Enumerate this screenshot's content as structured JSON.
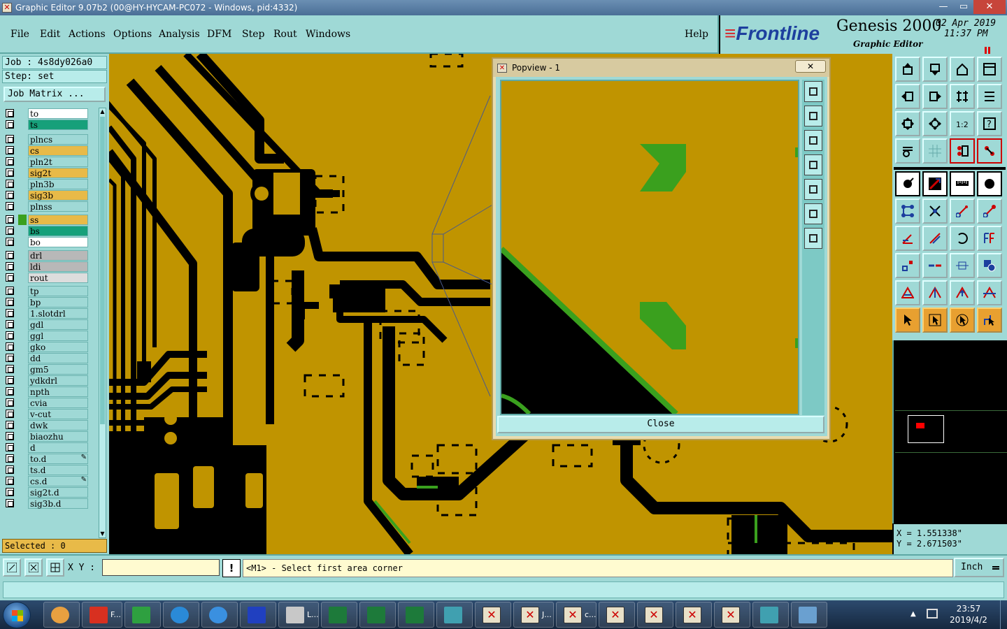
{
  "window": {
    "title": "Graphic Editor 9.07b2 (00@HY-HYCAM-PC072 - Windows, pid:4332)",
    "min_glyph": "—",
    "max_glyph": "▭",
    "close_glyph": "✕"
  },
  "menu": {
    "items": [
      "File",
      "Edit",
      "Actions",
      "Options",
      "Analysis",
      "DFM",
      "Step",
      "Rout",
      "Windows"
    ],
    "help": "Help"
  },
  "brand": {
    "logo_prefix": "≡",
    "logo": "Frontline",
    "product": "Genesis 2000",
    "subtitle": "Graphic Editor",
    "date": "02 Apr 2019",
    "time": "11:37 PM"
  },
  "left_panel": {
    "job": "Job : 4s8dy026a0",
    "step": "Step: set",
    "job_matrix": "Job Matrix ...",
    "selected": "Selected : 0",
    "layers": [
      {
        "name": "to",
        "color": "#ffffff",
        "swatch": "",
        "edit": false
      },
      {
        "name": "ts",
        "color": "#16a07a",
        "swatch": "",
        "edit": false
      },
      {
        "name": "plncs",
        "color": "#9fd9d6",
        "swatch": "",
        "edit": false
      },
      {
        "name": "cs",
        "color": "#e8ba48",
        "swatch": "",
        "edit": false
      },
      {
        "name": "pln2t",
        "color": "#9fd9d6",
        "swatch": "",
        "edit": false
      },
      {
        "name": "sig2t",
        "color": "#e8ba48",
        "swatch": "",
        "edit": false
      },
      {
        "name": "pln3b",
        "color": "#9fd9d6",
        "swatch": "",
        "edit": false
      },
      {
        "name": "sig3b",
        "color": "#e8ba48",
        "swatch": "",
        "edit": false
      },
      {
        "name": "plnss",
        "color": "#9fd9d6",
        "swatch": "",
        "edit": false
      },
      {
        "name": "ss",
        "color": "#e8ba48",
        "swatch": "#3aa01e",
        "edit": false
      },
      {
        "name": "bs",
        "color": "#16a07a",
        "swatch": "",
        "edit": false
      },
      {
        "name": "bo",
        "color": "#ffffff",
        "swatch": "",
        "edit": false
      },
      {
        "name": "drl",
        "color": "#b8b8b8",
        "swatch": "",
        "edit": false
      },
      {
        "name": "ldi",
        "color": "#b8b8b8",
        "swatch": "",
        "edit": false
      },
      {
        "name": "rout",
        "color": "#dddddd",
        "swatch": "",
        "edit": false
      },
      {
        "name": "tp",
        "color": "#9fd9d6",
        "swatch": "",
        "edit": false
      },
      {
        "name": "bp",
        "color": "#9fd9d6",
        "swatch": "",
        "edit": false
      },
      {
        "name": "1.slotdrl",
        "color": "#9fd9d6",
        "swatch": "",
        "edit": false
      },
      {
        "name": "gdl",
        "color": "#9fd9d6",
        "swatch": "",
        "edit": false
      },
      {
        "name": "ggl",
        "color": "#9fd9d6",
        "swatch": "",
        "edit": false
      },
      {
        "name": "gko",
        "color": "#9fd9d6",
        "swatch": "",
        "edit": false
      },
      {
        "name": "dd",
        "color": "#9fd9d6",
        "swatch": "",
        "edit": false
      },
      {
        "name": "gm5",
        "color": "#9fd9d6",
        "swatch": "",
        "edit": false
      },
      {
        "name": "ydkdrl",
        "color": "#9fd9d6",
        "swatch": "",
        "edit": false
      },
      {
        "name": "npth",
        "color": "#9fd9d6",
        "swatch": "",
        "edit": false
      },
      {
        "name": "cvia",
        "color": "#9fd9d6",
        "swatch": "",
        "edit": false
      },
      {
        "name": "v-cut",
        "color": "#9fd9d6",
        "swatch": "",
        "edit": false
      },
      {
        "name": "dwk",
        "color": "#9fd9d6",
        "swatch": "",
        "edit": false
      },
      {
        "name": "biaozhu",
        "color": "#9fd9d6",
        "swatch": "",
        "edit": false
      },
      {
        "name": "d",
        "color": "#9fd9d6",
        "swatch": "",
        "edit": false
      },
      {
        "name": "to.d",
        "color": "#9fd9d6",
        "swatch": "",
        "edit": true
      },
      {
        "name": "ts.d",
        "color": "#9fd9d6",
        "swatch": "",
        "edit": false
      },
      {
        "name": "cs.d",
        "color": "#9fd9d6",
        "swatch": "",
        "edit": true
      },
      {
        "name": "sig2t.d",
        "color": "#9fd9d6",
        "swatch": "",
        "edit": false
      },
      {
        "name": "sig3b.d",
        "color": "#9fd9d6",
        "swatch": "",
        "edit": false
      }
    ],
    "edit_glyph": "✎"
  },
  "popview": {
    "title": "Popview - 1",
    "close_x": "✕",
    "close_button": "Close"
  },
  "coords": {
    "x": "X = 1.551338\"",
    "y": "Y = 2.671503\""
  },
  "status": {
    "xy_label": "X Y :",
    "xy_value": "",
    "warn": "!",
    "prompt": "<M1> - Select first area corner",
    "units": "Inch"
  },
  "taskbar": {
    "tasks": [
      {
        "label": "",
        "icon": "shell-icon"
      },
      {
        "label": "F...",
        "icon": "genesis-icon"
      },
      {
        "label": "",
        "icon": "frontline-f-icon"
      },
      {
        "label": "",
        "icon": "ie-icon"
      },
      {
        "label": "",
        "icon": "bird-icon"
      },
      {
        "label": "",
        "icon": "floppy-icon"
      },
      {
        "label": "L...",
        "icon": "document-icon"
      },
      {
        "label": "",
        "icon": "excel-icon"
      },
      {
        "label": "",
        "icon": "excel-icon"
      },
      {
        "label": "",
        "icon": "excel-icon"
      },
      {
        "label": "",
        "icon": "eye-icon"
      },
      {
        "label": "",
        "icon": "x-window-icon"
      },
      {
        "label": "J...",
        "icon": "x-window-icon"
      },
      {
        "label": "c...",
        "icon": "x-window-icon"
      },
      {
        "label": "",
        "icon": "x-window-icon"
      },
      {
        "label": "",
        "icon": "x-window-icon"
      },
      {
        "label": "",
        "icon": "x-window-icon"
      },
      {
        "label": "",
        "icon": "x-window-icon"
      },
      {
        "label": "",
        "icon": "eye-icon"
      },
      {
        "label": "",
        "icon": "picture-icon"
      }
    ],
    "clock_time": "23:57",
    "clock_date": "2019/4/2",
    "tray_arrow": "▲"
  },
  "colors": {
    "panel": "#9fd9d6",
    "board": "#c09400",
    "copper": "#000000",
    "highlight": "#3aa01e",
    "active_border": "#cc0000"
  }
}
